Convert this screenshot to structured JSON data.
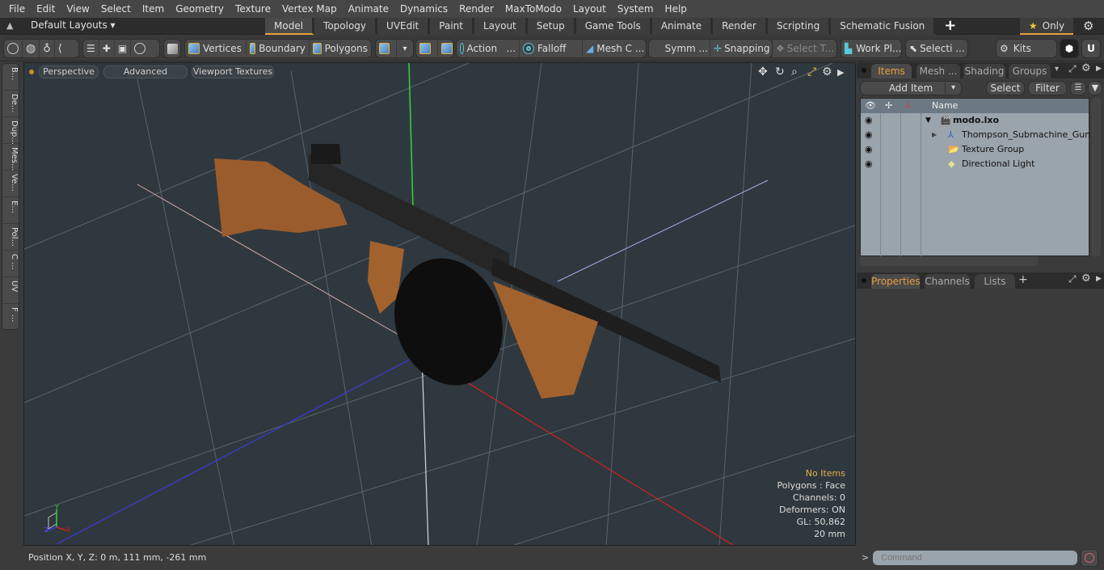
{
  "menu": [
    "File",
    "Edit",
    "View",
    "Select",
    "Item",
    "Geometry",
    "Texture",
    "Vertex Map",
    "Animate",
    "Dynamics",
    "Render",
    "MaxToModo",
    "Layout",
    "System",
    "Help"
  ],
  "layout": {
    "default_layouts": "Default Layouts",
    "tabs": [
      "Model",
      "Topology",
      "UVEdit",
      "Paint",
      "Layout",
      "Setup",
      "Game Tools",
      "Animate",
      "Render",
      "Scripting",
      "Schematic Fusion"
    ],
    "active_tab": "Model",
    "plus": "+",
    "only_label": "Only"
  },
  "toolbar": {
    "vertices": "Vertices",
    "boundary": "Boundary",
    "polygons": "Polygons",
    "action": "Action",
    "action_more": "...",
    "falloff": "Falloff",
    "mesh_c": "Mesh C ...",
    "symm": "Symm ...",
    "snapping": "Snapping",
    "select_t": "Select T...",
    "work_pl": "Work Pl...",
    "selecti": "Selecti ...",
    "kits": "Kits"
  },
  "left_tabs": [
    "B...",
    "De...",
    "Dup...",
    "Mes...",
    "Ve...",
    "E...",
    "Pol...",
    "C ...",
    "UV",
    "F ..."
  ],
  "viewport": {
    "perspective": "Perspective",
    "advanced": "Advanced",
    "viewport_textures": "Viewport Textures",
    "info": {
      "no_items": "No Items",
      "polygons": "Polygons : Face",
      "channels": "Channels: 0",
      "deformers": "Deformers: ON",
      "gl": "GL: 50,862",
      "scale": "20 mm"
    },
    "axis_labels": {
      "x": "X",
      "y": "Y",
      "z": "Z"
    }
  },
  "status": {
    "position": "Position X, Y, Z:   0 m, 111 mm, -261 mm"
  },
  "items_panel": {
    "tabs": [
      "Items",
      "Mesh ...",
      "Shading",
      "Groups"
    ],
    "active_tab": "Items",
    "add_item": "Add Item",
    "select": "Select",
    "filter": "Filter",
    "col_name": "Name",
    "rows": [
      {
        "label": "modo.lxo",
        "bold": true,
        "icon": "scene-clapper-icon"
      },
      {
        "label": "Thompson_Submachine_Gun",
        "bold": false,
        "icon": "locator-axes-icon"
      },
      {
        "label": "Texture Group",
        "bold": false,
        "icon": "folder-icon"
      },
      {
        "label": "Directional Light",
        "bold": false,
        "icon": "light-icon"
      }
    ]
  },
  "properties_panel": {
    "tabs": [
      "Properties",
      "Channels",
      "Lists"
    ],
    "active_tab": "Properties",
    "plus": "+"
  },
  "command": {
    "prompt": ">",
    "placeholder": "Command"
  },
  "colors": {
    "accent": "#e6a03a",
    "viewport_bg": "#2f383e",
    "list_bg": "#9aa4ad"
  }
}
